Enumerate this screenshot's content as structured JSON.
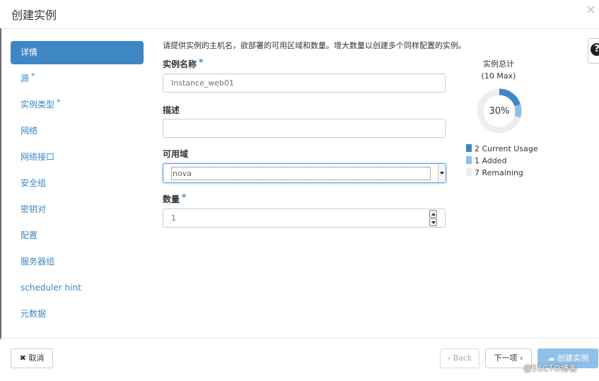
{
  "modal": {
    "title": "创建实例",
    "close_symbol": "✕"
  },
  "sidebar": {
    "items": [
      {
        "label": "详情",
        "required": false,
        "active": true
      },
      {
        "label": "源",
        "required": true
      },
      {
        "label": "实例类型",
        "required": true
      },
      {
        "label": "网络",
        "required": false
      },
      {
        "label": "网络接口",
        "required": false
      },
      {
        "label": "安全组",
        "required": false
      },
      {
        "label": "密钥对",
        "required": false
      },
      {
        "label": "配置",
        "required": false
      },
      {
        "label": "服务器组",
        "required": false
      },
      {
        "label": "scheduler hint",
        "required": false
      },
      {
        "label": "元数据",
        "required": false
      }
    ],
    "required_marker": "*"
  },
  "help": {
    "symbol": "?"
  },
  "form": {
    "intro": "请提供实例的主机名，欲部署的可用区域和数量。增大数量以创建多个同样配置的实例。",
    "instance_name": {
      "label": "实例名称",
      "value": "Instance_web01"
    },
    "description": {
      "label": "描述",
      "value": ""
    },
    "availability_zone": {
      "label": "可用域",
      "value": "nova"
    },
    "count": {
      "label": "数量",
      "value": "1"
    }
  },
  "quota": {
    "title": "实例总计",
    "subtitle": "(10 Max)",
    "percent_label": "30%",
    "current": 2,
    "added": 1,
    "remaining": 7,
    "legend": [
      {
        "count": "2",
        "label": "Current Usage",
        "color": "#3f86c4"
      },
      {
        "count": "1",
        "label": "Added",
        "color": "#8fbfe3"
      },
      {
        "count": "7",
        "label": "Remaining",
        "color": "#eeeeee"
      }
    ]
  },
  "footer": {
    "cancel_icon": "✖",
    "cancel_label": "取消",
    "back_label": "‹ Back",
    "next_label": "下一项 ›",
    "create_icon": "☁",
    "create_label": "创建实例"
  },
  "watermark": "@51CTO博客"
}
